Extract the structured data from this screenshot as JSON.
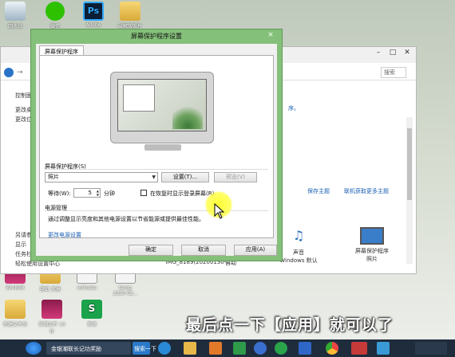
{
  "desktop": {
    "icons": [
      {
        "label": "回收站",
        "kind": "recycle"
      },
      {
        "label": "微信",
        "kind": "wechat"
      },
      {
        "label": "Adobe",
        "kind": "ps"
      },
      {
        "label": "破解版照片",
        "kind": "folder"
      },
      {
        "label": "WinRAR",
        "kind": "winrar"
      },
      {
        "label": "壁纸 风景",
        "kind": "folder"
      },
      {
        "label": "onlinetu",
        "kind": "doc"
      },
      {
        "label": "temp 2020-02...",
        "kind": "doc"
      },
      {
        "label": "新建文件夹",
        "kind": "folder"
      },
      {
        "label": "压缩文件 10年",
        "kind": "winrar"
      },
      {
        "label": "表格",
        "kind": "green"
      }
    ]
  },
  "explorer": {
    "search_placeholder": "搜索",
    "sidebar": [
      "控制面",
      "更改桌",
      "更改位"
    ],
    "sidebar_bottom": [
      "另请参",
      "显示",
      "任务栏",
      "轻松使用设置中心"
    ],
    "link_text": "序。",
    "actions": [
      "保存主题",
      "联机获取更多主题"
    ],
    "thumbs": [
      {
        "label": "IMG_8189(20200130-1..."
      },
      {
        "label": "自动"
      },
      {
        "label": "声音",
        "sub": "Windows 默认"
      },
      {
        "label": "屏幕保护程序",
        "sub": "照片"
      }
    ]
  },
  "dialog": {
    "title": "屏幕保护程序设置",
    "close_icon": "×",
    "tab": "屏幕保护程序",
    "screensaver_group": "屏幕保护程序(S)",
    "screensaver_value": "照片",
    "settings_button": "设置(T)...",
    "preview_button": "预览(V)",
    "wait_label": "等待(W):",
    "wait_value": "5",
    "wait_unit": "分钟",
    "resume_label": "在恢复时显示登录屏幕(R)",
    "power_group": "电源管理",
    "power_text": "通过调整显示亮度和其他电源设置以节省能源或提供最佳性能。",
    "power_link": "更改电源设置",
    "ok_button": "确定",
    "cancel_button": "取消",
    "apply_button": "应用(A)"
  },
  "caption": "最后点一下【应用】就可以了",
  "taskbar": {
    "items": [
      {
        "label": "金银潮联长记功奖励"
      },
      {
        "label": "搜索一下"
      }
    ]
  }
}
